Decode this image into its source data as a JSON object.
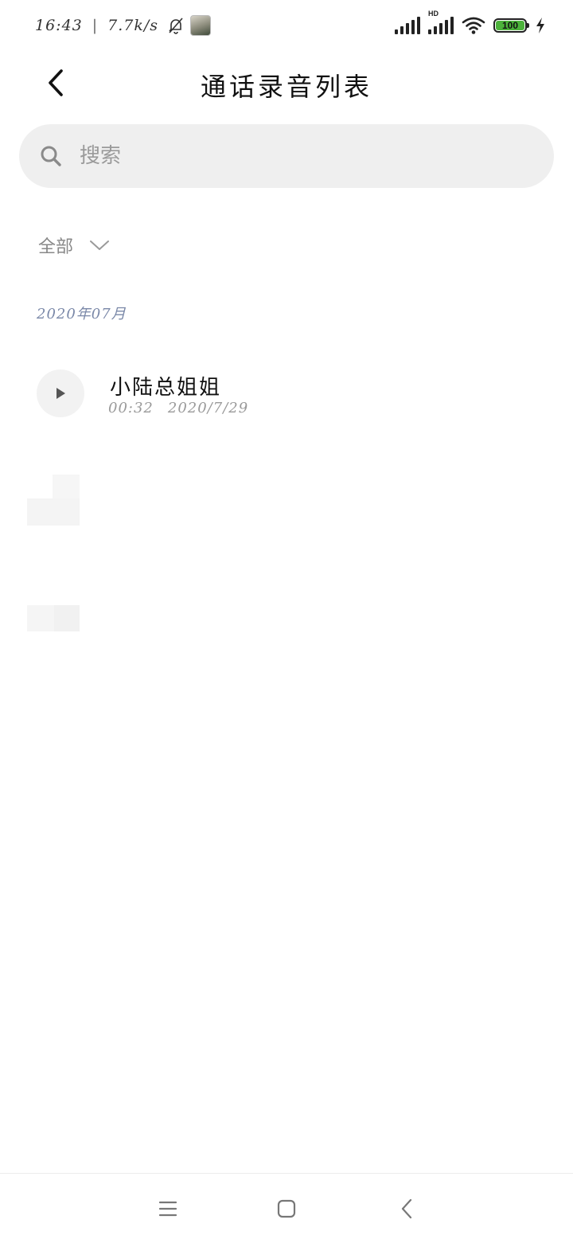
{
  "status_bar": {
    "time": "16:43",
    "separator": "|",
    "net_speed": "7.7k/s",
    "battery_level": "100",
    "icons": {
      "notifications_off": "bell-off-icon",
      "avatar": "avatar",
      "signal_1": "signal-icon",
      "signal_2": "signal-hd-icon",
      "hd_label": "HD",
      "wifi": "wifi-icon",
      "charging": "charging-icon"
    },
    "colors": {
      "battery_fill": "#4cb23b"
    }
  },
  "header": {
    "back_icon": "back-arrow-icon",
    "title": "通话录音列表"
  },
  "search": {
    "icon": "search-icon",
    "placeholder": "搜索",
    "value": ""
  },
  "filter": {
    "label": "全部",
    "icon": "chevron-down-icon"
  },
  "sections": [
    {
      "header": "2020年07月",
      "recordings": [
        {
          "name": "小陆总姐姐",
          "duration": "00:32",
          "date": "2020/7/29",
          "play_icon": "play-icon"
        }
      ]
    }
  ],
  "nav_bar": {
    "menu_icon": "menu-icon",
    "home_icon": "home-icon",
    "back_icon": "back-icon"
  }
}
